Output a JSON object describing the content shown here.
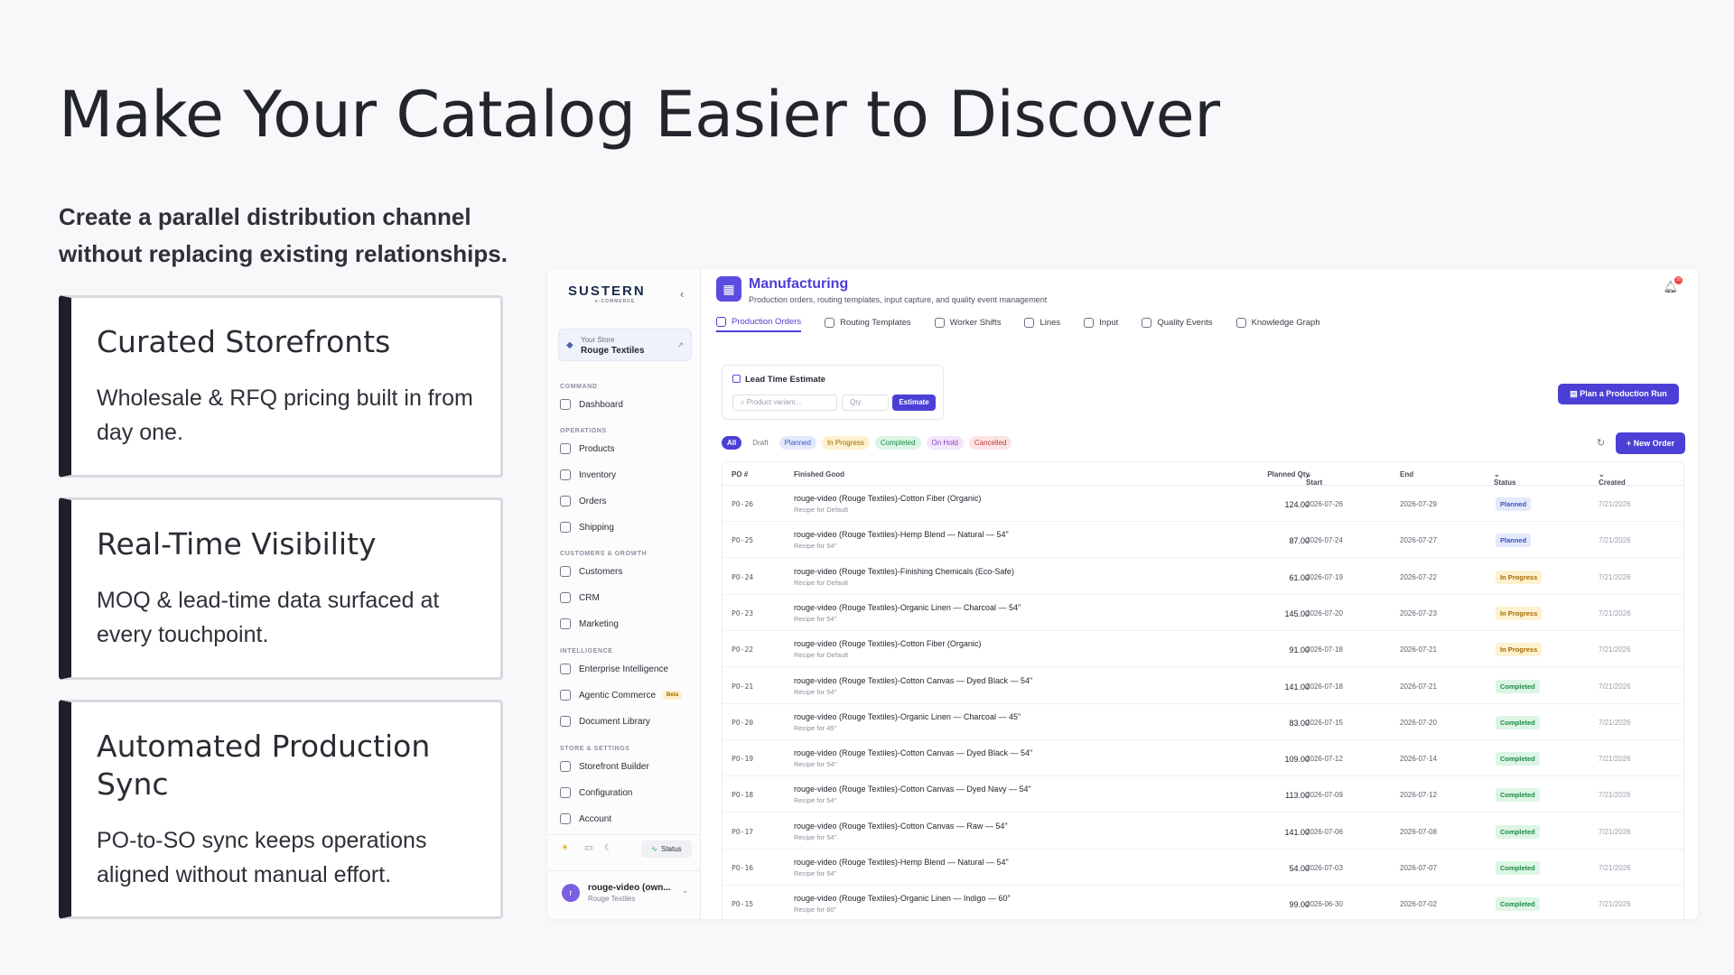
{
  "headline": "Make Your Catalog Easier to Discover",
  "subhead": "Create a parallel distribution channel without replacing existing relationships.",
  "cards": [
    {
      "title": "Curated Storefronts",
      "body": "Wholesale & RFQ pricing built in from day one."
    },
    {
      "title": "Real-Time Visibility",
      "body": "MOQ & lead-time data surfaced at every touchpoint."
    },
    {
      "title": "Automated Production Sync",
      "body": "PO-to-SO sync keeps operations aligned without manual effort."
    }
  ],
  "app": {
    "logo": "SUSTERN",
    "logo_sub": "e-COMMERCE",
    "store": {
      "label": "Your Store",
      "name": "Rouge Textiles"
    },
    "sections": {
      "command": "COMMAND",
      "operations": "OPERATIONS",
      "customers": "CUSTOMERS & GROWTH",
      "intelligence": "INTELLIGENCE",
      "store": "STORE & SETTINGS"
    },
    "nav": {
      "dashboard": "Dashboard",
      "products": "Products",
      "inventory": "Inventory",
      "orders": "Orders",
      "shipping": "Shipping",
      "customers": "Customers",
      "crm": "CRM",
      "marketing": "Marketing",
      "enterprise": "Enterprise Intelligence",
      "agentic": "Agentic Commerce",
      "agentic_badge": "Beta",
      "doclib": "Document Library",
      "storefront": "Storefront Builder",
      "config": "Configuration",
      "account": "Account"
    },
    "status_btn": "Status",
    "user": {
      "initial": "r",
      "name": "rouge-video (own...",
      "org": "Rouge Textiles"
    },
    "module": {
      "title": "Manufacturing",
      "subtitle": "Production orders, routing templates, input capture, and quality event management",
      "notif_count": "10"
    },
    "tabs": [
      "Production Orders",
      "Routing Templates",
      "Worker Shifts",
      "Lines",
      "Input",
      "Quality Events",
      "Knowledge Graph"
    ],
    "lead_time": {
      "title": "Lead Time Estimate",
      "variant_placeholder": "Product variant...",
      "qty_placeholder": "Qty",
      "button": "Estimate"
    },
    "plan_button": "Plan a Production Run",
    "new_order_button": "+ New Order",
    "filters": [
      "All",
      "Draft",
      "Planned",
      "In Progress",
      "Completed",
      "On Hold",
      "Cancelled"
    ],
    "columns": {
      "po": "PO #",
      "good": "Finished Good",
      "qty": "Planned Qty",
      "start": "Start",
      "end": "End",
      "status": "Status",
      "created": "Created"
    },
    "rows": [
      {
        "po": "PO-26",
        "good": "rouge-video (Rouge Textiles)-Cotton Fiber (Organic)",
        "recipe": "Recipe for Default",
        "qty": "124.00",
        "start": "2026-07-26",
        "end": "2026-07-29",
        "status": "Planned",
        "created": "7/21/2026"
      },
      {
        "po": "PO-25",
        "good": "rouge-video (Rouge Textiles)-Hemp Blend — Natural — 54\"",
        "recipe": "Recipe for 54\"",
        "qty": "87.00",
        "start": "2026-07-24",
        "end": "2026-07-27",
        "status": "Planned",
        "created": "7/21/2026"
      },
      {
        "po": "PO-24",
        "good": "rouge-video (Rouge Textiles)-Finishing Chemicals (Eco-Safe)",
        "recipe": "Recipe for Default",
        "qty": "61.00",
        "start": "2026-07-19",
        "end": "2026-07-22",
        "status": "In Progress",
        "created": "7/21/2026"
      },
      {
        "po": "PO-23",
        "good": "rouge-video (Rouge Textiles)-Organic Linen — Charcoal — 54\"",
        "recipe": "Recipe for 54\"",
        "qty": "145.00",
        "start": "2026-07-20",
        "end": "2026-07-23",
        "status": "In Progress",
        "created": "7/21/2026"
      },
      {
        "po": "PO-22",
        "good": "rouge-video (Rouge Textiles)-Cotton Fiber (Organic)",
        "recipe": "Recipe for Default",
        "qty": "91.00",
        "start": "2026-07-18",
        "end": "2026-07-21",
        "status": "In Progress",
        "created": "7/21/2026"
      },
      {
        "po": "PO-21",
        "good": "rouge-video (Rouge Textiles)-Cotton Canvas — Dyed Black — 54\"",
        "recipe": "Recipe for 54\"",
        "qty": "141.00",
        "start": "2026-07-18",
        "end": "2026-07-21",
        "status": "Completed",
        "created": "7/21/2026"
      },
      {
        "po": "PO-20",
        "good": "rouge-video (Rouge Textiles)-Organic Linen — Charcoal — 45\"",
        "recipe": "Recipe for 45\"",
        "qty": "83.00",
        "start": "2026-07-15",
        "end": "2026-07-20",
        "status": "Completed",
        "created": "7/21/2026"
      },
      {
        "po": "PO-19",
        "good": "rouge-video (Rouge Textiles)-Cotton Canvas — Dyed Black — 54\"",
        "recipe": "Recipe for 54\"",
        "qty": "109.00",
        "start": "2026-07-12",
        "end": "2026-07-14",
        "status": "Completed",
        "created": "7/21/2026"
      },
      {
        "po": "PO-18",
        "good": "rouge-video (Rouge Textiles)-Cotton Canvas — Dyed Navy — 54\"",
        "recipe": "Recipe for 54\"",
        "qty": "113.00",
        "start": "2026-07-09",
        "end": "2026-07-12",
        "status": "Completed",
        "created": "7/21/2026"
      },
      {
        "po": "PO-17",
        "good": "rouge-video (Rouge Textiles)-Cotton Canvas — Raw — 54\"",
        "recipe": "Recipe for 54\"",
        "qty": "141.00",
        "start": "2026-07-06",
        "end": "2026-07-08",
        "status": "Completed",
        "created": "7/21/2026"
      },
      {
        "po": "PO-16",
        "good": "rouge-video (Rouge Textiles)-Hemp Blend — Natural — 54\"",
        "recipe": "Recipe for 54\"",
        "qty": "54.00",
        "start": "2026-07-03",
        "end": "2026-07-07",
        "status": "Completed",
        "created": "7/21/2026"
      },
      {
        "po": "PO-15",
        "good": "rouge-video (Rouge Textiles)-Organic Linen — Indigo — 60\"",
        "recipe": "Recipe for 60\"",
        "qty": "99.00",
        "start": "2026-06-30",
        "end": "2026-07-02",
        "status": "Completed",
        "created": "7/21/2026"
      }
    ],
    "colors": {
      "accent": "#4c3fd6",
      "planned": "#3a55c4",
      "in_progress": "#a46a00",
      "completed": "#1e8a4a"
    }
  }
}
